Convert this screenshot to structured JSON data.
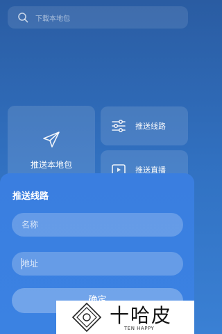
{
  "search": {
    "placeholder": "下载本地包"
  },
  "tiles": [
    {
      "label": "推送本地包",
      "icon": "send-icon"
    },
    {
      "label": "推送线路",
      "icon": "sliders-icon"
    },
    {
      "label": "推送直播",
      "icon": "video-play-icon"
    }
  ],
  "dialog": {
    "title": "推送线路",
    "name_placeholder": "名称",
    "address_placeholder": "地址",
    "confirm_label": "确定"
  },
  "watermark": {
    "name": "十哈皮",
    "sub": "TEN HAPPY"
  },
  "colors": {
    "background": "#2a5ca2",
    "sheet": "#3a7ee0"
  }
}
